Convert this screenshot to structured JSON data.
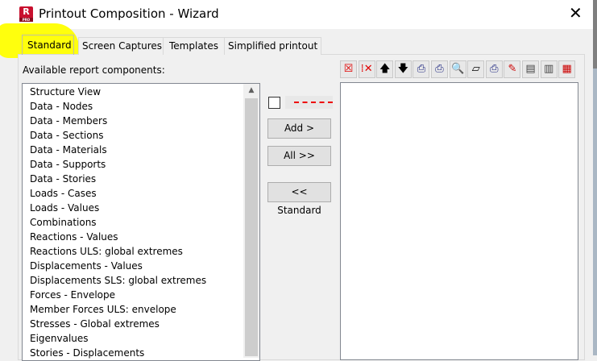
{
  "window": {
    "title": "Printout Composition - Wizard",
    "app_icon": "R",
    "app_icon_sub": "PRO",
    "close": "✕"
  },
  "tabs": [
    "Standard",
    "Screen Captures",
    "Templates",
    "Simplified printout"
  ],
  "active_tab": "Standard",
  "left": {
    "label": "Available report components:",
    "items": [
      "Structure View",
      "Data - Nodes",
      "Data - Members",
      "Data - Sections",
      "Data - Materials",
      "Data - Supports",
      "Data - Stories",
      "Loads - Cases",
      "Loads - Values",
      "Combinations",
      "Reactions - Values",
      "Reactions ULS: global extremes",
      "Displacements - Values",
      "Displacements SLS: global extremes",
      "Forces - Envelope",
      "Member Forces ULS: envelope",
      "Stresses - Global extremes",
      "Eigenvalues",
      "Stories - Displacements"
    ]
  },
  "middle": {
    "add": "Add >",
    "all": "All >>",
    "standard": "<< Standard",
    "line_color": "#e00000"
  },
  "toolbar": [
    {
      "icon": "delete-icon",
      "glyph": "☒",
      "color": "#e00000"
    },
    {
      "icon": "delete-all-icon",
      "glyph": "⁞✕",
      "color": "#e00000"
    },
    {
      "icon": "arrow-up-icon",
      "glyph": "🡅",
      "color": "#000"
    },
    {
      "icon": "arrow-down-icon",
      "glyph": "🡇",
      "color": "#000"
    },
    {
      "icon": "print-check-icon",
      "glyph": "⎙",
      "color": "#1a237e"
    },
    {
      "icon": "print-exclude-icon",
      "glyph": "⎙",
      "color": "#1a237e"
    },
    {
      "icon": "preview-icon",
      "glyph": "🔍",
      "color": "#1565c0"
    },
    {
      "icon": "page-setup-icon",
      "glyph": "▱",
      "color": "#000"
    },
    {
      "icon": "printer-icon",
      "glyph": "⎙",
      "color": "#1a237e"
    },
    {
      "icon": "edit-icon",
      "glyph": "✎",
      "color": "#c00"
    },
    {
      "icon": "save-template-icon",
      "glyph": "▤",
      "color": "#444"
    },
    {
      "icon": "load-template-icon",
      "glyph": "▥",
      "color": "#444"
    },
    {
      "icon": "page-layout-icon",
      "glyph": "▦",
      "color": "#c00"
    }
  ]
}
